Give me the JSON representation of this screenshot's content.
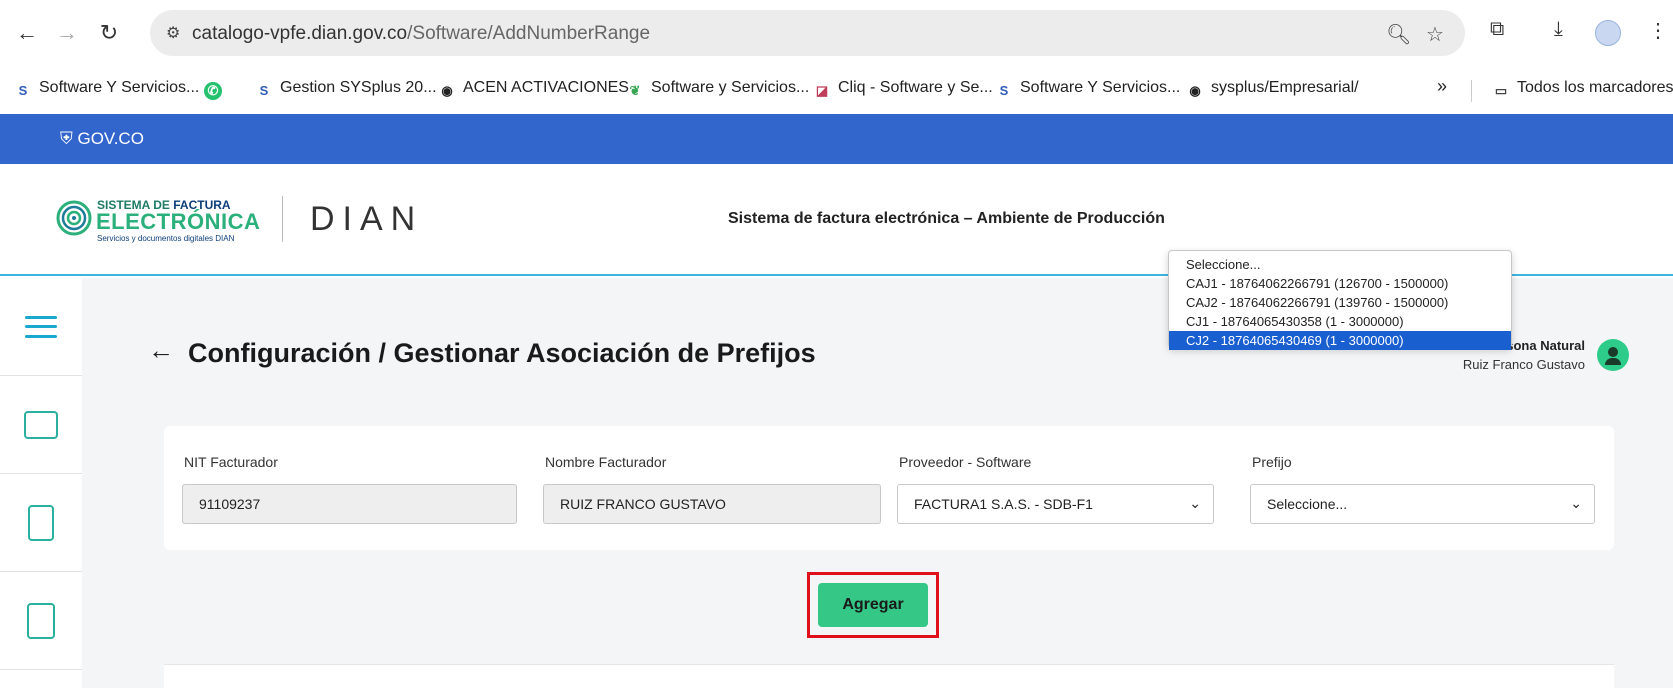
{
  "browser": {
    "url_host": "catalogo-vpfe.dian.gov.co",
    "url_path": "/Software/AddNumberRange",
    "bookmarks": [
      {
        "label": "Software Y Servicios...",
        "icon": "sysplus-icon"
      },
      {
        "label": "",
        "icon": "whatsapp-icon"
      },
      {
        "label": "Gestion SYSplus 20...",
        "icon": "sysplus-icon"
      },
      {
        "label": "ACEN ACTIVACIONES",
        "icon": "globe-icon"
      },
      {
        "label": "Software y Servicios...",
        "icon": "leaf-icon"
      },
      {
        "label": "Cliq - Software y Se...",
        "icon": "cliq-icon"
      },
      {
        "label": "Software Y Servicios...",
        "icon": "sysplus-icon"
      },
      {
        "label": "sysplus/Empresarial/",
        "icon": "globe-icon"
      }
    ],
    "more_label": "»",
    "all_bookmarks_label": "Todos los marcadores"
  },
  "gov": {
    "label": "GOV.CO"
  },
  "header": {
    "logo_line1_a": "SISTEMA DE ",
    "logo_line1_b": "FACTURA",
    "logo_line2": "ELECTRÓNICA",
    "logo_line3": "Servicios y documentos digitales DIAN",
    "dian": "DIAN",
    "title": "Sistema de factura electrónica – Ambiente de Producción"
  },
  "page": {
    "title": "Configuración / Gestionar Asociación de Prefijos",
    "user_type": "Persona Natural",
    "user_name": "Ruiz Franco Gustavo"
  },
  "form": {
    "nit_label": "NIT Facturador",
    "nit_value": "91109237",
    "nombre_label": "Nombre Facturador",
    "nombre_value": "RUIZ FRANCO GUSTAVO",
    "proveedor_label": "Proveedor - Software",
    "proveedor_value": "FACTURA1 S.A.S. - SDB-F1",
    "prefijo_label": "Prefijo",
    "prefijo_value": "Seleccione...",
    "prefijo_options": [
      "Seleccione...",
      "CAJ1 - 18764062266791 (126700 - 1500000)",
      "CAJ2 - 18764062266791 (139760 - 1500000)",
      "CJ1 - 18764065430358 (1 - 3000000)",
      "CJ2 - 18764065430469 (1 - 3000000)"
    ],
    "selected_option_index": 4,
    "add_button": "Agregar"
  },
  "colors": {
    "gov_blue": "#3366cc",
    "accent_green": "#34c786",
    "highlight_red": "#e0101a",
    "selected_blue": "#1a5fcf"
  }
}
